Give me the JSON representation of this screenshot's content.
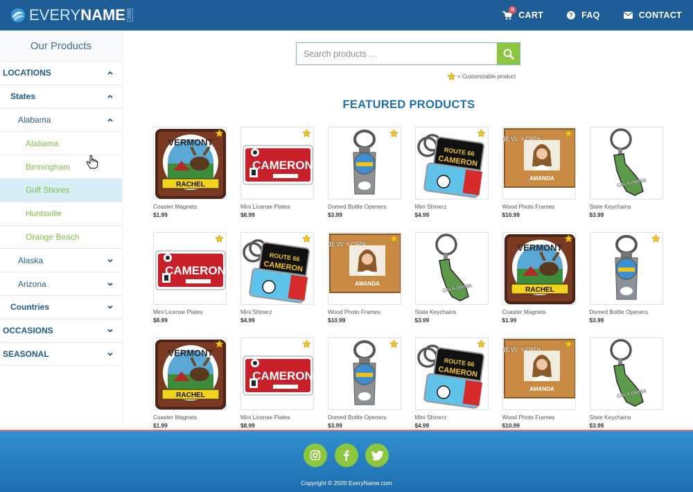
{
  "header": {
    "logo_main": "EVERY",
    "logo_bold": "NAME",
    "logo_suffix": ".com",
    "nav": [
      {
        "label": "CART",
        "icon": "cart-icon",
        "badge": "0"
      },
      {
        "label": "FAQ",
        "icon": "question-circle-icon"
      },
      {
        "label": "CONTACT",
        "icon": "envelope-icon"
      }
    ]
  },
  "sidebar": {
    "title": "Our Products",
    "items": [
      {
        "label": "LOCATIONS",
        "level": 0,
        "expanded": true
      },
      {
        "label": "States",
        "level": 1,
        "expanded": true
      },
      {
        "label": "Alabama",
        "level": 2,
        "expanded": true
      },
      {
        "label": "Alabama",
        "level": 3
      },
      {
        "label": "Birmingham",
        "level": 3
      },
      {
        "label": "Gulf Shores",
        "level": 3,
        "active": true
      },
      {
        "label": "Huntsville",
        "level": 3
      },
      {
        "label": "Orange Beach",
        "level": 3
      },
      {
        "label": "Alaska",
        "level": 2,
        "expanded": false
      },
      {
        "label": "Arizona",
        "level": 2,
        "expanded": false
      },
      {
        "label": "Countries",
        "level": 1,
        "expanded": false
      },
      {
        "label": "OCCASIONS",
        "level": 0,
        "expanded": false
      },
      {
        "label": "SEASONAL",
        "level": 0,
        "expanded": false
      }
    ]
  },
  "search": {
    "placeholder": "Search products …",
    "value": ""
  },
  "legend": {
    "text": "= Customizable product"
  },
  "featured": {
    "title": "FEATURED PRODUCTS",
    "products": [
      {
        "name": "Coaster Magnets",
        "price": "$1.99",
        "customizable": true,
        "kind": "coaster"
      },
      {
        "name": "Mini License Plates",
        "price": "$8.99",
        "customizable": true,
        "kind": "plate"
      },
      {
        "name": "Domed Bottle Openers",
        "price": "$3.99",
        "customizable": true,
        "kind": "opener"
      },
      {
        "name": "Mini Shinerz",
        "price": "$4.99",
        "customizable": true,
        "kind": "shinerz"
      },
      {
        "name": "Wood Photo Frames",
        "price": "$10.99",
        "customizable": true,
        "kind": "frame"
      },
      {
        "name": "State Keychains",
        "price": "$3.99",
        "customizable": false,
        "kind": "keychain"
      },
      {
        "name": "Mini License Plates",
        "price": "$8.99",
        "customizable": true,
        "kind": "plate"
      },
      {
        "name": "Mini Shinerz",
        "price": "$4.99",
        "customizable": true,
        "kind": "shinerz"
      },
      {
        "name": "Wood Photo Frames",
        "price": "$10.99",
        "customizable": true,
        "kind": "frame"
      },
      {
        "name": "State Keychains",
        "price": "$3.99",
        "customizable": false,
        "kind": "keychain"
      },
      {
        "name": "Coaster Magnets",
        "price": "$1.99",
        "customizable": true,
        "kind": "coaster"
      },
      {
        "name": "Domed Bottle Openers",
        "price": "$3.99",
        "customizable": true,
        "kind": "opener"
      },
      {
        "name": "Coaster Magnets",
        "price": "$1.99",
        "customizable": true,
        "kind": "coaster"
      },
      {
        "name": "Mini License Plates",
        "price": "$8.99",
        "customizable": true,
        "kind": "plate"
      },
      {
        "name": "Domed Bottle Openers",
        "price": "$3.99",
        "customizable": true,
        "kind": "opener"
      },
      {
        "name": "Mini Shinerz",
        "price": "$4.99",
        "customizable": true,
        "kind": "shinerz"
      },
      {
        "name": "Wood Photo Frames",
        "price": "$10.99",
        "customizable": true,
        "kind": "frame"
      },
      {
        "name": "State Keychains",
        "price": "$3.99",
        "customizable": false,
        "kind": "keychain"
      }
    ],
    "image_text": {
      "vermont": "VERMONT",
      "rachel": "RACHEL",
      "cameron": "CAMERON",
      "route66": "ROUTE 66",
      "newyork": "NEW YORK",
      "amanda": "AMANDA",
      "california": "CALIFORNIA"
    }
  },
  "footer": {
    "social": [
      {
        "icon": "instagram-icon"
      },
      {
        "icon": "facebook-icon"
      },
      {
        "icon": "twitter-icon"
      }
    ],
    "copyright": "Copyright © 2020 EveryName.com"
  },
  "colors": {
    "header_bg": "#1f5d96",
    "accent_green": "#8cc63f",
    "link_blue": "#1e5b8a",
    "active_row": "#d7eef7",
    "star": "#f5c518"
  }
}
